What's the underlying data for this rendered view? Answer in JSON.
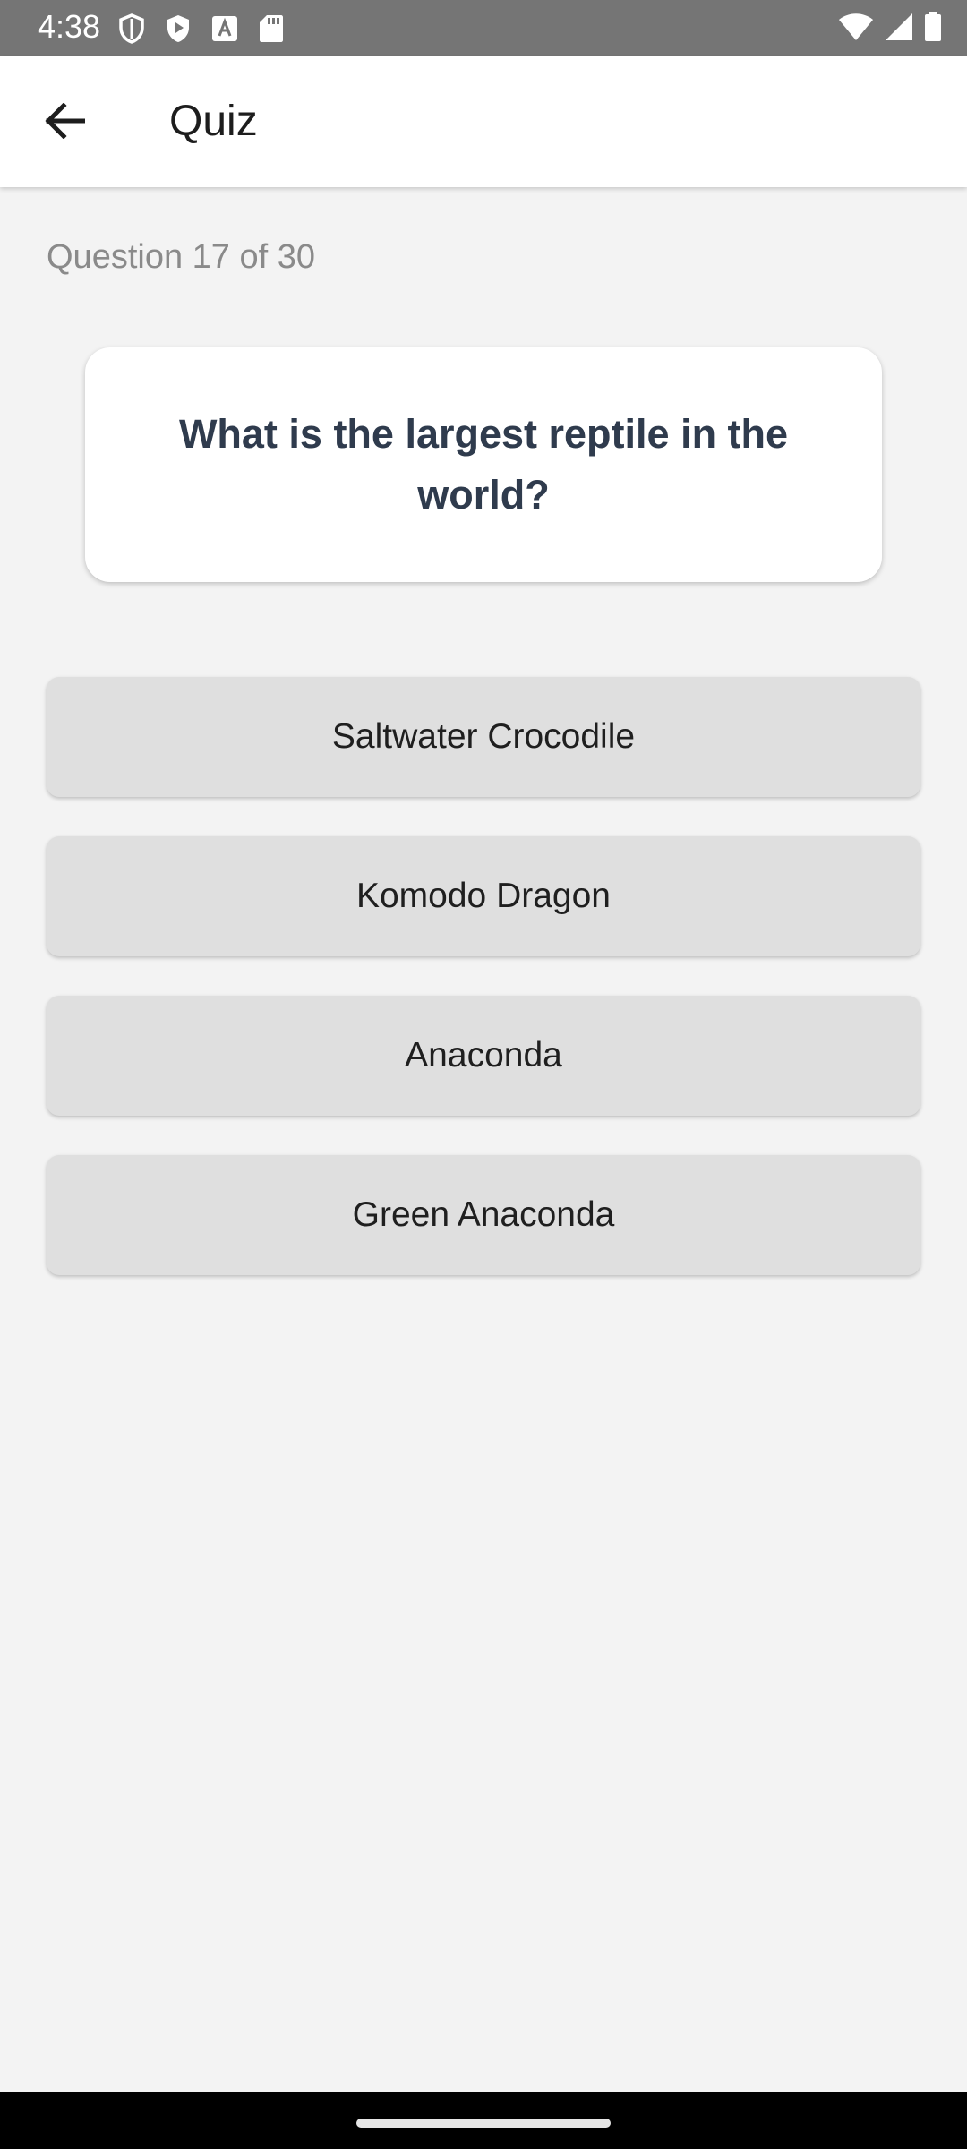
{
  "status_bar": {
    "time": "4:38",
    "left_icons": [
      "shield-outline-icon",
      "shield-play-icon",
      "font-a-icon",
      "sd-card-icon"
    ],
    "right_icons": [
      "wifi-icon",
      "signal-icon",
      "battery-icon"
    ]
  },
  "app_bar": {
    "title": "Quiz",
    "back_icon": "arrow-back-icon"
  },
  "quiz": {
    "progress": "Question 17 of 30",
    "question": "What is the largest reptile in the world?",
    "answers": [
      "Saltwater Crocodile",
      "Komodo Dragon",
      "Anaconda",
      "Green Anaconda"
    ]
  },
  "colors": {
    "status_bar": "#757575",
    "background": "#f3f3f3",
    "card": "#ffffff",
    "answer_button": "#dfdfdf",
    "question_text": "#2f3b4d"
  }
}
